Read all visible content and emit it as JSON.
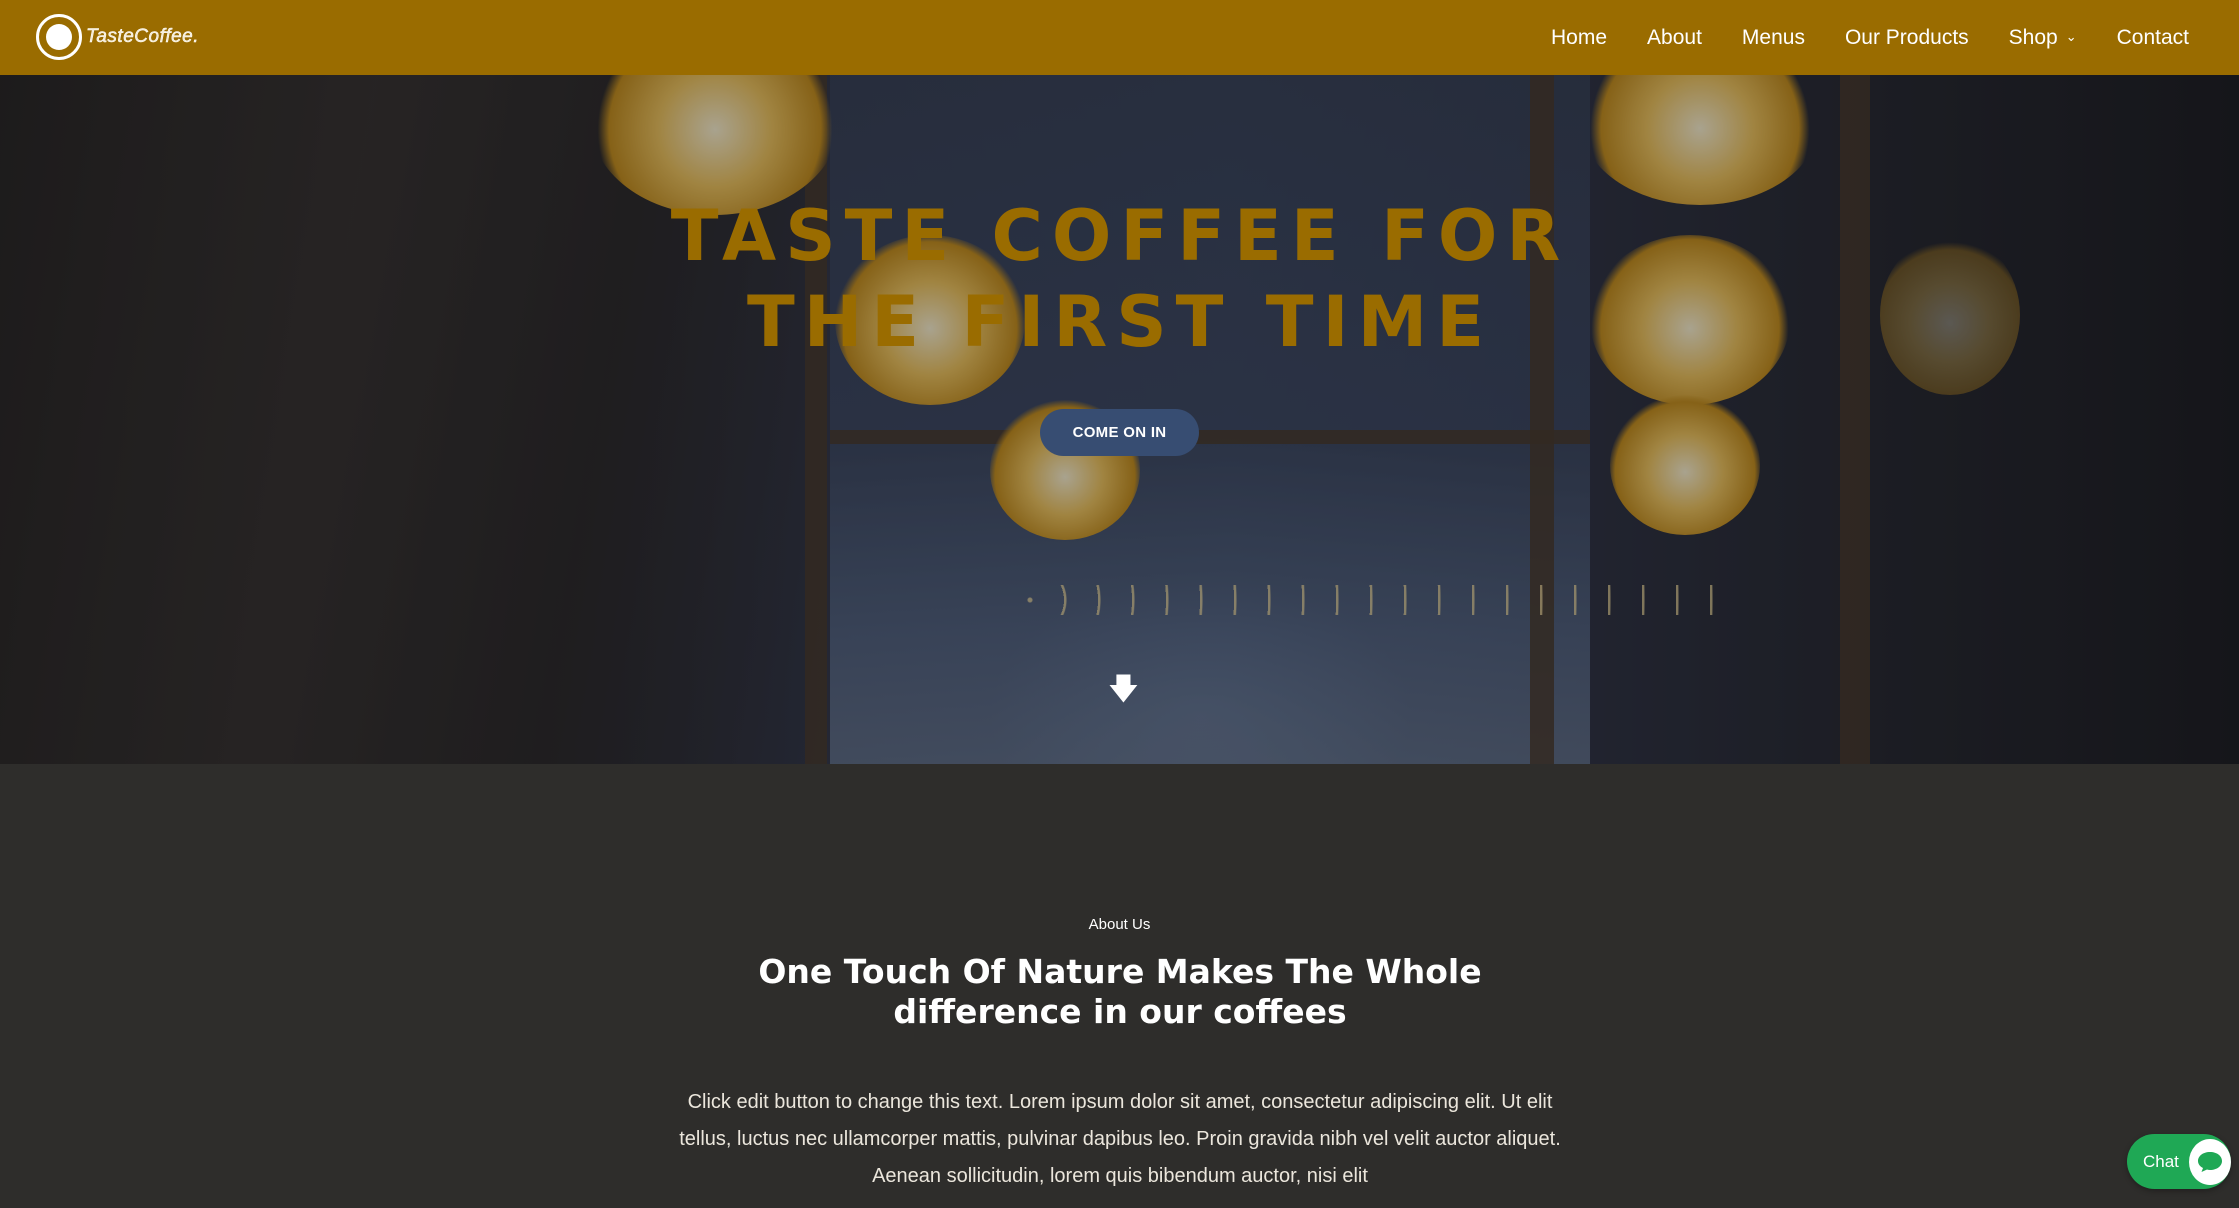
{
  "header": {
    "logo_text": "TasteCoffee.",
    "nav": [
      {
        "label": "Home"
      },
      {
        "label": "About"
      },
      {
        "label": "Menus"
      },
      {
        "label": "Our Products"
      },
      {
        "label": "Shop"
      },
      {
        "label": "Contact"
      }
    ]
  },
  "hero": {
    "title": "TASTE COFFEE FOR THE FIRST TIME",
    "cta_label": "COME ON IN",
    "scroll_icon": "arrow-down-icon"
  },
  "about": {
    "eyebrow": "About Us",
    "title": "One Touch Of Nature Makes The Whole difference in our coffees",
    "body": "Click edit button to change this text. Lorem ipsum dolor sit amet, consectetur adipiscing elit. Ut elit tellus, luctus nec ullamcorper mattis, pulvinar dapibus leo. Proin gravida nibh vel velit auctor aliquet. Aenean sollicitudin, lorem quis bibendum auctor, nisi elit"
  },
  "chat": {
    "label": "Chat",
    "icon": "chat-bubble-icon"
  },
  "colors": {
    "header_bg": "#9a6c00",
    "hero_title": "#9a6c00",
    "cta_bg": "#374d72",
    "section_bg": "#2e2d2b",
    "chat_bg": "#1fa855"
  }
}
